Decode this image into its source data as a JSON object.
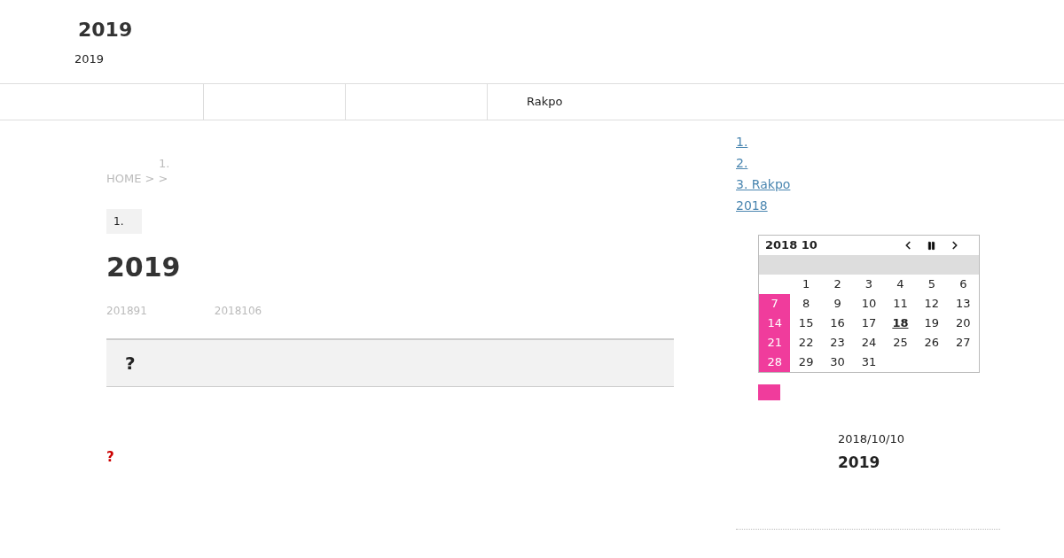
{
  "site": {
    "title": "2019",
    "tagline": "2019"
  },
  "nav": [
    {
      "label": "Rakpo"
    }
  ],
  "breadcrumb": {
    "note": "1.",
    "trail": "HOME > >"
  },
  "category": "1.",
  "article": {
    "title": "2019",
    "meta": [
      "201891",
      "2018106"
    ],
    "box_heading": "?",
    "note": "?"
  },
  "sidebar": {
    "links": [
      {
        "label": "1."
      },
      {
        "label": "2."
      },
      {
        "label": "3. Rakpo"
      },
      {
        "label": "2018"
      }
    ],
    "calendar": {
      "title": "2018 10",
      "weeks": [
        [
          {
            "kind": "blank"
          },
          {
            "kind": "day",
            "day": "1",
            "holiday": false,
            "today": false
          },
          {
            "kind": "day",
            "day": "2",
            "holiday": false,
            "today": false
          },
          {
            "kind": "day",
            "day": "3",
            "holiday": false,
            "today": false
          },
          {
            "kind": "day",
            "day": "4",
            "holiday": false,
            "today": false
          },
          {
            "kind": "day",
            "day": "5",
            "holiday": false,
            "today": false
          },
          {
            "kind": "day",
            "day": "6",
            "holiday": false,
            "today": false
          }
        ],
        [
          {
            "kind": "day",
            "day": "7",
            "holiday": true,
            "today": false
          },
          {
            "kind": "day",
            "day": "8",
            "holiday": false,
            "today": false
          },
          {
            "kind": "day",
            "day": "9",
            "holiday": false,
            "today": false
          },
          {
            "kind": "day",
            "day": "10",
            "holiday": false,
            "today": false
          },
          {
            "kind": "day",
            "day": "11",
            "holiday": false,
            "today": false
          },
          {
            "kind": "day",
            "day": "12",
            "holiday": false,
            "today": false
          },
          {
            "kind": "day",
            "day": "13",
            "holiday": false,
            "today": false
          }
        ],
        [
          {
            "kind": "day",
            "day": "14",
            "holiday": true,
            "today": false
          },
          {
            "kind": "day",
            "day": "15",
            "holiday": false,
            "today": false
          },
          {
            "kind": "day",
            "day": "16",
            "holiday": false,
            "today": false
          },
          {
            "kind": "day",
            "day": "17",
            "holiday": false,
            "today": false
          },
          {
            "kind": "day",
            "day": "18",
            "holiday": false,
            "today": true
          },
          {
            "kind": "day",
            "day": "19",
            "holiday": false,
            "today": false
          },
          {
            "kind": "day",
            "day": "20",
            "holiday": false,
            "today": false
          }
        ],
        [
          {
            "kind": "day",
            "day": "21",
            "holiday": true,
            "today": false
          },
          {
            "kind": "day",
            "day": "22",
            "holiday": false,
            "today": false
          },
          {
            "kind": "day",
            "day": "23",
            "holiday": false,
            "today": false
          },
          {
            "kind": "day",
            "day": "24",
            "holiday": false,
            "today": false
          },
          {
            "kind": "day",
            "day": "25",
            "holiday": false,
            "today": false
          },
          {
            "kind": "day",
            "day": "26",
            "holiday": false,
            "today": false
          },
          {
            "kind": "day",
            "day": "27",
            "holiday": false,
            "today": false
          }
        ],
        [
          {
            "kind": "day",
            "day": "28",
            "holiday": true,
            "today": false
          },
          {
            "kind": "day",
            "day": "29",
            "holiday": false,
            "today": false
          },
          {
            "kind": "day",
            "day": "30",
            "holiday": false,
            "today": false
          },
          {
            "kind": "day",
            "day": "31",
            "holiday": false,
            "today": false
          },
          {
            "kind": "blank"
          },
          {
            "kind": "blank"
          },
          {
            "kind": "blank"
          }
        ]
      ]
    },
    "posts": [
      {
        "date": "2018/10/10",
        "title": "2019"
      }
    ]
  }
}
